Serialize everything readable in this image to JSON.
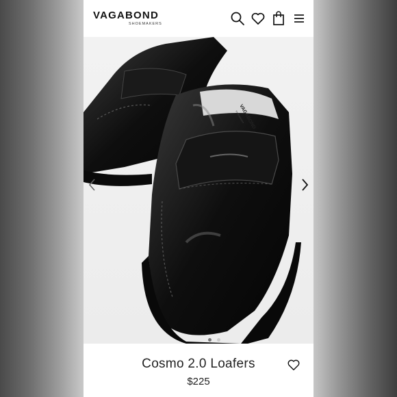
{
  "header": {
    "brand": "VAGABOND",
    "brand_sub": "SHOEMAKERS",
    "icons": [
      "search-icon",
      "heart-icon",
      "bag-icon",
      "menu-icon"
    ]
  },
  "gallery": {
    "image_subject": "black leather penny loafers",
    "slide_count": 2,
    "active_slide": 0,
    "shoe_brand_print": "VAGABOND",
    "shoe_sub_print": "SHOEMAKERS"
  },
  "product": {
    "name": "Cosmo 2.0 Loafers",
    "price": "$225"
  },
  "colors": {
    "accent": "#111111",
    "background": "#ffffff"
  }
}
